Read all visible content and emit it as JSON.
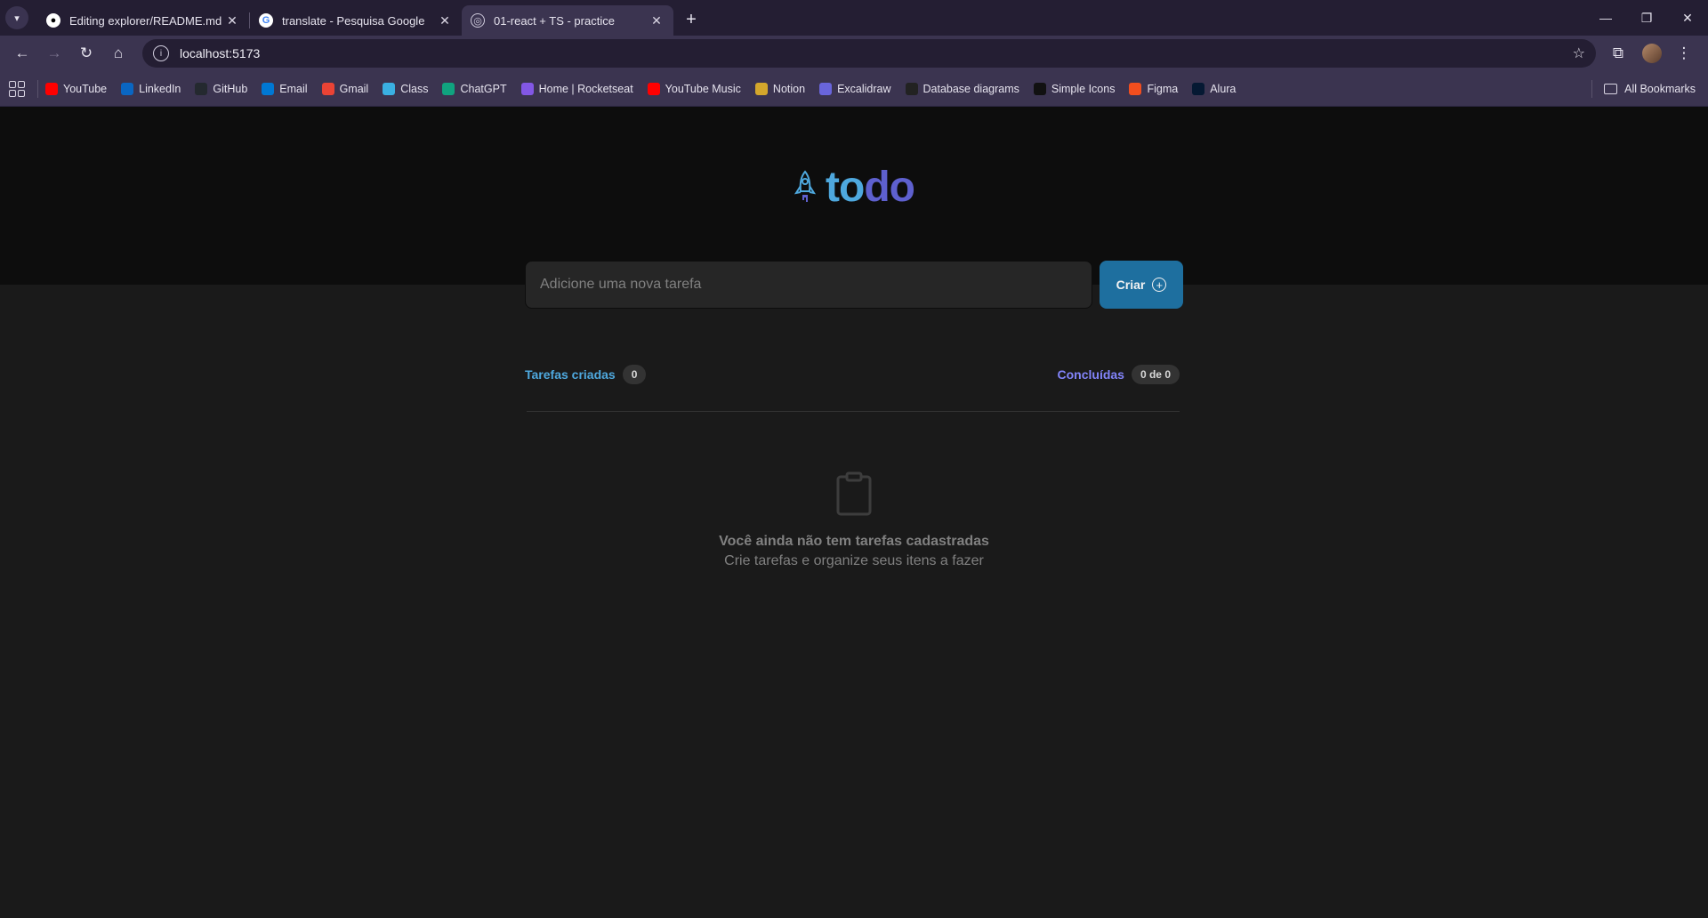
{
  "browser": {
    "tabs": [
      {
        "title": "Editing explorer/README.md at",
        "icon": "github-icon",
        "active": false
      },
      {
        "title": "translate - Pesquisa Google",
        "icon": "google-icon",
        "active": false
      },
      {
        "title": "01-react + TS - practice",
        "icon": "globe-icon",
        "active": true
      }
    ],
    "url": "localhost:5173",
    "bookmarks": [
      {
        "label": "YouTube",
        "icon": "youtube-icon",
        "color": "#ff0000"
      },
      {
        "label": "LinkedIn",
        "icon": "linkedin-icon",
        "color": "#0a66c2"
      },
      {
        "label": "GitHub",
        "icon": "github-icon",
        "color": "#24292f"
      },
      {
        "label": "Email",
        "icon": "outlook-icon",
        "color": "#0078d4"
      },
      {
        "label": "Gmail",
        "icon": "gmail-icon",
        "color": "#ea4335"
      },
      {
        "label": "Class",
        "icon": "class-icon",
        "color": "#3ab0e2"
      },
      {
        "label": "ChatGPT",
        "icon": "chatgpt-icon",
        "color": "#10a37f"
      },
      {
        "label": "Home | Rocketseat",
        "icon": "rocketseat-icon",
        "color": "#8257e5"
      },
      {
        "label": "YouTube Music",
        "icon": "youtube-music-icon",
        "color": "#ff0000"
      },
      {
        "label": "Notion",
        "icon": "notion-icon",
        "color": "#d4a72c"
      },
      {
        "label": "Excalidraw",
        "icon": "excalidraw-icon",
        "color": "#6965db"
      },
      {
        "label": "Database diagrams",
        "icon": "database-icon",
        "color": "#222222"
      },
      {
        "label": "Simple Icons",
        "icon": "simple-icons-icon",
        "color": "#111111"
      },
      {
        "label": "Figma",
        "icon": "figma-icon",
        "color": "#f24e1e"
      },
      {
        "label": "Alura",
        "icon": "alura-icon",
        "color": "#051933"
      }
    ],
    "all_bookmarks": "All Bookmarks"
  },
  "app": {
    "logo_part1": "to",
    "logo_part2": "do",
    "input_placeholder": "Adicione uma nova tarefa",
    "create_label": "Criar",
    "created_label": "Tarefas criadas",
    "created_count": "0",
    "done_label": "Concluídas",
    "done_count": "0 de 0",
    "empty_title": "Você ainda não tem tarefas cadastradas",
    "empty_subtitle": "Crie tarefas e organize seus itens a fazer",
    "colors": {
      "blue": "#4ea8de",
      "purple": "#5e60ce",
      "purple_light": "#8284fa",
      "button": "#1e6f9f"
    }
  }
}
